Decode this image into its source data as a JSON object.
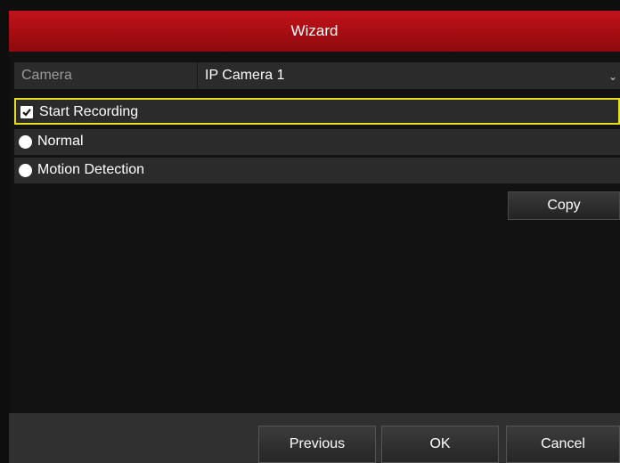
{
  "window": {
    "title": "Wizard"
  },
  "camera": {
    "label": "Camera",
    "selected": "IP Camera 1"
  },
  "options": {
    "start_recording": {
      "label": "Start Recording",
      "checked": true
    },
    "normal": {
      "label": "Normal",
      "selected": false
    },
    "motion_detection": {
      "label": "Motion Detection",
      "selected": false
    }
  },
  "buttons": {
    "copy": "Copy",
    "previous": "Previous",
    "ok": "OK",
    "cancel": "Cancel"
  },
  "colors": {
    "title_bar": "#b01016",
    "focus_outline": "#e7df20",
    "panel": "#2b2b2b"
  },
  "icons": {
    "select_arrow": "chevron-down-icon",
    "checkbox": "checkbox-checked-icon",
    "radio": "radio-icon"
  }
}
